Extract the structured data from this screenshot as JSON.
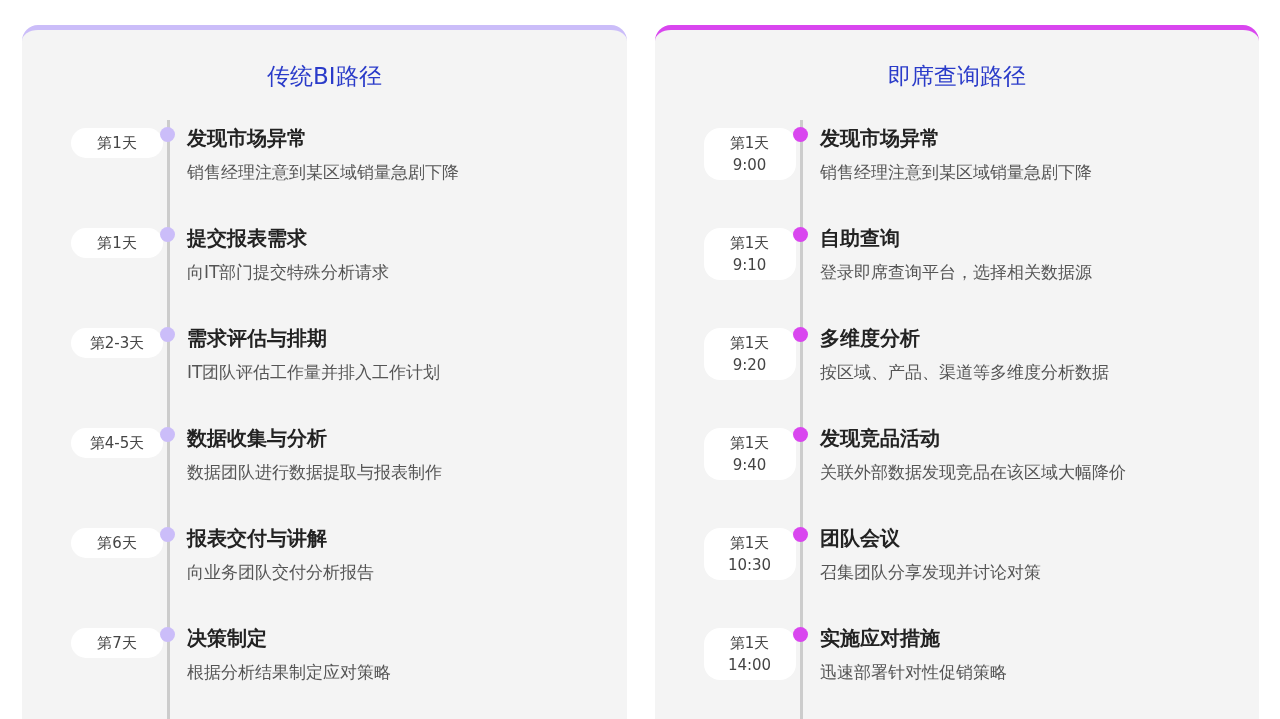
{
  "panels": [
    {
      "title": "传统BI路径",
      "color": "#cbbdf9",
      "steps": [
        {
          "day": "第1天",
          "title": "发现市场异常",
          "description": "销售经理注意到某区域销量急剧下降"
        },
        {
          "day": "第1天",
          "title": "提交报表需求",
          "description": "向IT部门提交特殊分析请求"
        },
        {
          "day": "第2-3天",
          "title": "需求评估与排期",
          "description": "IT团队评估工作量并排入工作计划"
        },
        {
          "day": "第4-5天",
          "title": "数据收集与分析",
          "description": "数据团队进行数据提取与报表制作"
        },
        {
          "day": "第6天",
          "title": "报表交付与讲解",
          "description": "向业务团队交付分析报告"
        },
        {
          "day": "第7天",
          "title": "决策制定",
          "description": "根据分析结果制定应对策略"
        }
      ]
    },
    {
      "title": "即席查询路径",
      "color": "#d946ef",
      "steps": [
        {
          "day": "第1天",
          "time": "9:00",
          "title": "发现市场异常",
          "description": "销售经理注意到某区域销量急剧下降"
        },
        {
          "day": "第1天",
          "time": "9:10",
          "title": "自助查询",
          "description": "登录即席查询平台，选择相关数据源"
        },
        {
          "day": "第1天",
          "time": "9:20",
          "title": "多维度分析",
          "description": "按区域、产品、渠道等多维度分析数据"
        },
        {
          "day": "第1天",
          "time": "9:40",
          "title": "发现竞品活动",
          "description": "关联外部数据发现竞品在该区域大幅降价"
        },
        {
          "day": "第1天",
          "time": "10:30",
          "title": "团队会议",
          "description": "召集团队分享发现并讨论对策"
        },
        {
          "day": "第1天",
          "time": "14:00",
          "title": "实施应对措施",
          "description": "迅速部署针对性促销策略"
        }
      ]
    }
  ]
}
